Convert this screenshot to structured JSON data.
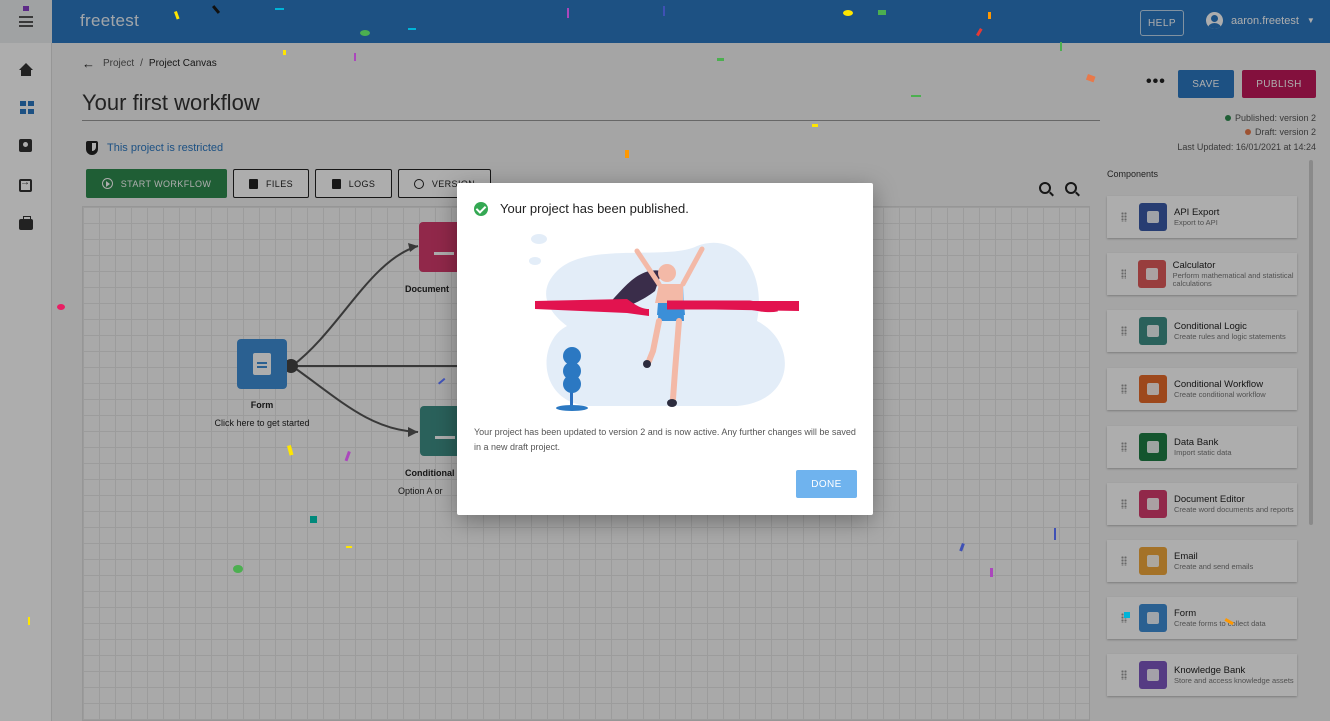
{
  "app": {
    "brand": "freetest",
    "help_label": "HELP",
    "username": "aaron.freetest"
  },
  "breadcrumb": {
    "parent": "Project",
    "separator": "/",
    "current": "Project Canvas"
  },
  "page": {
    "title": "Your first workflow",
    "restricted_text": "This project is restricted"
  },
  "toolbar": {
    "start_label": "START WORKFLOW",
    "files_label": "FILES",
    "logs_label": "LOGS",
    "version_label": "VERSION"
  },
  "canvas": {
    "form_node": {
      "title": "Form",
      "subtitle": "Click here to get started"
    },
    "document_node": {
      "title": "Document"
    },
    "conditional_node": {
      "title": "Conditional",
      "subtitle": "Option A or"
    }
  },
  "actions": {
    "more_label": "•••",
    "save_label": "SAVE",
    "publish_label": "PUBLISH"
  },
  "status": {
    "published": "Published: version 2",
    "draft": "Draft: version 2",
    "last_updated": "Last Updated: 16/01/2021 at 14:24",
    "published_color": "#2e8b4f",
    "draft_color": "#e8794a"
  },
  "components": {
    "heading": "Components",
    "items": [
      {
        "name": "API Export",
        "desc": "Export to API",
        "color": "#3a5aa8",
        "icon": "cloud-upload-icon"
      },
      {
        "name": "Calculator",
        "desc": "Perform mathematical and statistical calculations",
        "color": "#e05a5a",
        "icon": "calculator-icon"
      },
      {
        "name": "Conditional Logic",
        "desc": "Create rules and logic statements",
        "color": "#3f8f86",
        "icon": "sitemap-icon"
      },
      {
        "name": "Conditional Workflow",
        "desc": "Create conditional workflow",
        "color": "#e86a2a",
        "icon": "fork-icon"
      },
      {
        "name": "Data Bank",
        "desc": "Import static data",
        "color": "#1e7e45",
        "icon": "excel-icon"
      },
      {
        "name": "Document Editor",
        "desc": "Create word documents and reports",
        "color": "#d63c6e",
        "icon": "chart-doc-icon"
      },
      {
        "name": "Email",
        "desc": "Create and send emails",
        "color": "#f2a93b",
        "icon": "envelope-icon"
      },
      {
        "name": "Form",
        "desc": "Create forms to collect data",
        "color": "#3e8ed6",
        "icon": "form-icon"
      },
      {
        "name": "Knowledge Bank",
        "desc": "Store and access knowledge assets",
        "color": "#7e57c2",
        "icon": "brain-icon"
      }
    ]
  },
  "modal": {
    "title": "Your project has been published.",
    "body": "Your project has been updated to version 2 and is now active. Any further changes will be saved in a new draft project.",
    "done_label": "DONE"
  }
}
